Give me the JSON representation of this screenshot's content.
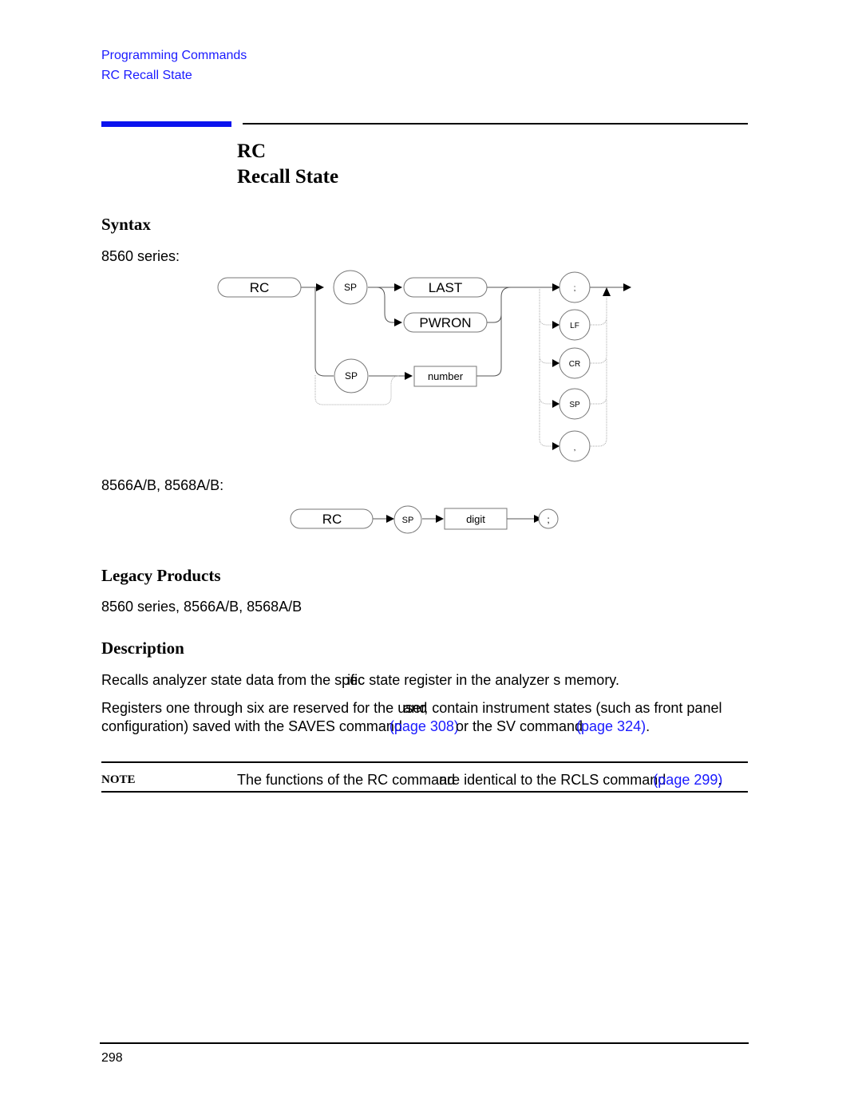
{
  "breadcrumb": {
    "section": "Programming Commands",
    "page": "RC Recall State"
  },
  "title": {
    "command": "RC",
    "name": "Recall State"
  },
  "syntax": {
    "heading": "Syntax",
    "diagram1_label": "8560 series:",
    "diagram1": {
      "start": "RC",
      "sp1": "SP",
      "options": [
        "LAST",
        "PWRON"
      ],
      "sp2": "SP",
      "param": "number",
      "terminators": [
        ";",
        "LF",
        "CR",
        "SP",
        ","
      ]
    },
    "diagram2_label": "8566A/B, 8568A/B:",
    "diagram2": {
      "start": "RC",
      "sp": "SP",
      "param": "digit",
      "terminator": ";"
    }
  },
  "legacy": {
    "heading": "Legacy Products",
    "text": "8560 series, 8566A/B, 8568A/B"
  },
  "description": {
    "heading": "Description",
    "p1": {
      "a": "Recalls analyzer state data from the spec",
      "b": "ific",
      "c": "state register in the analyzer s memory."
    },
    "p2_line1": {
      "a": "Registers one through six are reserved for the user",
      "b": "and",
      "c": ", contain instrument states (such as front panel"
    },
    "p2_line2": {
      "a": "configuration) saved with the SAVES command",
      "link1": "(page 308)",
      "b": "or the SV command",
      "link2": "(page 324)",
      "c": "."
    }
  },
  "note": {
    "label": "NOTE",
    "a": "The functions of the RC command",
    "b": "are identical to the RCLS command",
    "link": "(page 299)",
    "c": "."
  },
  "footer": {
    "page_number": "298"
  }
}
